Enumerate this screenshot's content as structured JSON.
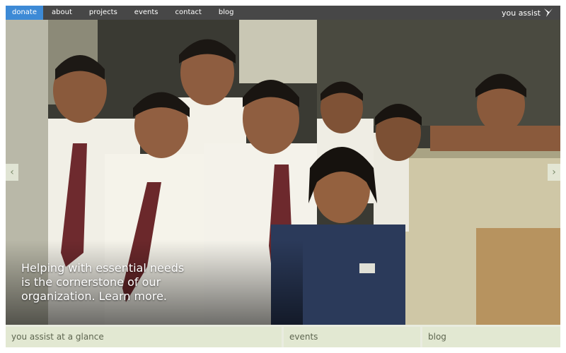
{
  "nav": {
    "donate": "donate",
    "about": "about",
    "projects": "projects",
    "events": "events",
    "contact": "contact",
    "blog": "blog",
    "brand": "you assist"
  },
  "hero": {
    "caption_line1": "Helping with essential needs",
    "caption_line2": "is the cornerstone of our",
    "caption_line3": "organization. Learn more.",
    "prev_arrow": "‹",
    "next_arrow": "›"
  },
  "tabs": {
    "glance": "you assist at a glance",
    "events": "events",
    "blog": "blog"
  },
  "colors": {
    "nav_bg": "#474747",
    "donate_bg": "#3d8ad6",
    "tab_bg": "#e2e8d2",
    "tab_text": "#5e6650"
  },
  "icons": {
    "brand_logo": "bird-logo-icon",
    "prev": "chevron-left-icon",
    "next": "chevron-right-icon"
  }
}
